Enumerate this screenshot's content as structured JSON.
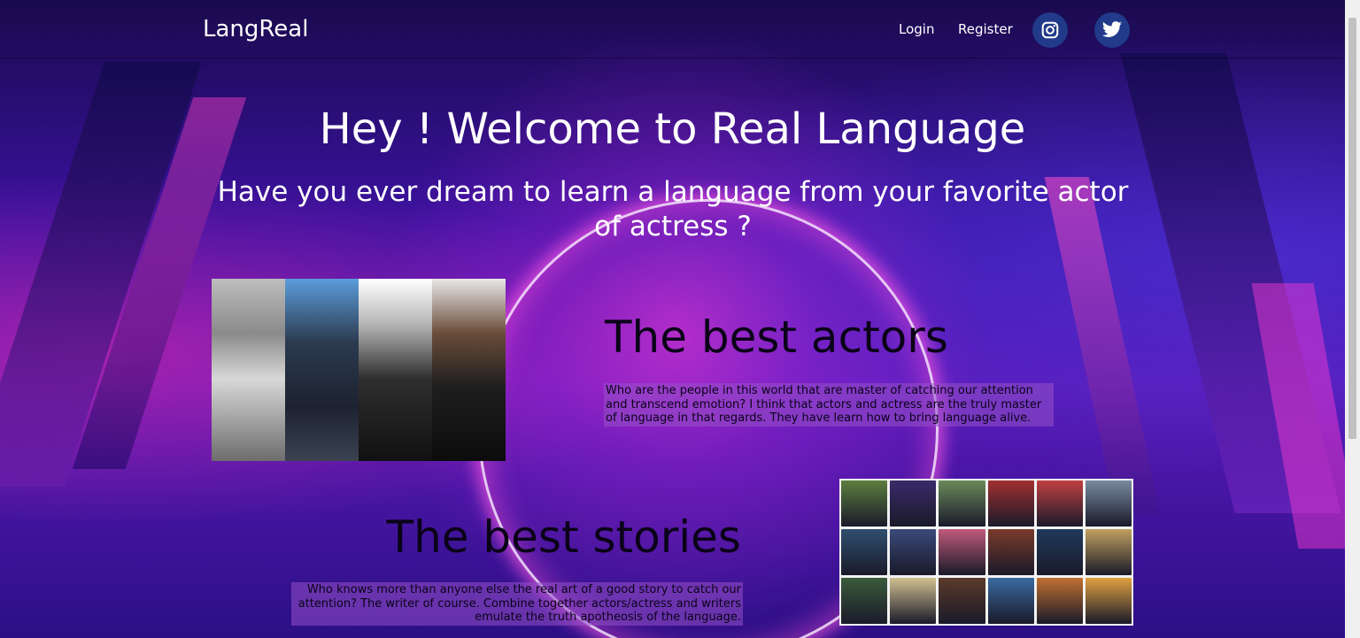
{
  "navbar": {
    "brand": "LangReal",
    "login_label": "Login",
    "register_label": "Register",
    "social": [
      {
        "icon": "instagram-icon"
      },
      {
        "icon": "twitter-icon"
      }
    ]
  },
  "hero": {
    "title": "Hey ! Welcome to Real Language",
    "subtitle": "Have you ever dream to learn a language from your favorite actor of actress ?"
  },
  "actors_section": {
    "title": "The best actors",
    "text": "Who are the people in this world that are master of catching our attention and transcend emotion? I think that actors and actress are the truly master of language in that regards. They have learn how to bring language alive."
  },
  "stories_section": {
    "title": "The best stories",
    "text": "Who knows more than anyone else the real art of a good story to catch our attention? The writer of course. Combine together actors/actress and writers emulate the truth apotheosis of the language."
  },
  "colors": {
    "social_bg": "#213a8a",
    "section_text_bg": "#9650c8",
    "dark_text": "#0a0318"
  },
  "poster_colors": [
    "#5c7f3f",
    "#3a2a6a",
    "#6a8a5a",
    "#a03030",
    "#c04040",
    "#7a8aa0",
    "#2f4f6f",
    "#3a4a7a",
    "#c05a7a",
    "#7a3a2a",
    "#1f3a5a",
    "#c0a060",
    "#3a5a3a",
    "#d0c090",
    "#5a3a2a",
    "#3a6aa0",
    "#c07030",
    "#e0a040"
  ]
}
